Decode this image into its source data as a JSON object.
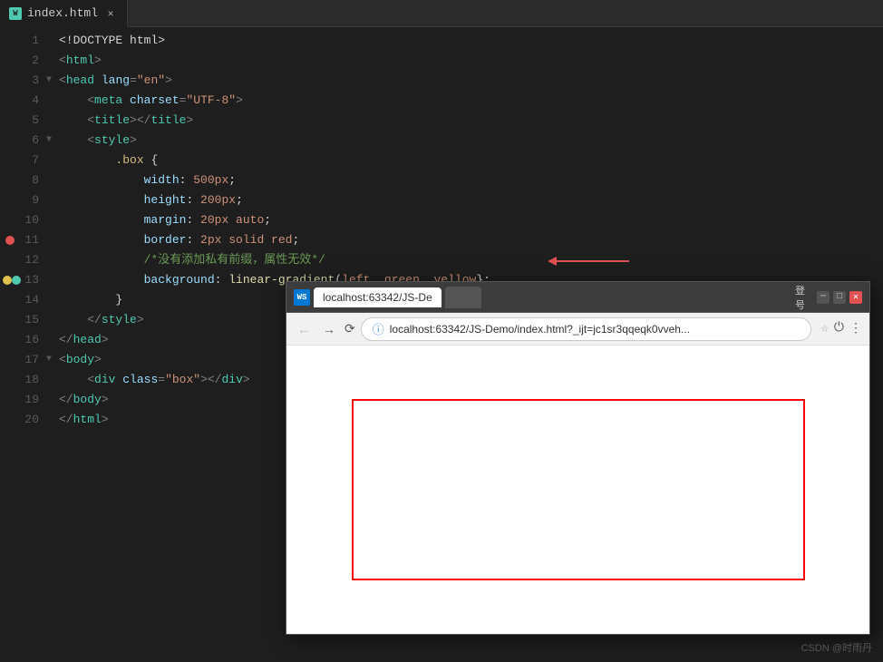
{
  "tab": {
    "name": "index.html",
    "icon_text": "WS"
  },
  "lines": [
    {
      "num": 1,
      "tokens": [
        {
          "t": "<!DOCTYPE html>",
          "c": "text-white"
        }
      ]
    },
    {
      "num": 2,
      "tokens": [
        {
          "t": "<",
          "c": "punct"
        },
        {
          "t": "html",
          "c": "tag"
        },
        {
          "t": ">",
          "c": "punct"
        }
      ]
    },
    {
      "num": 3,
      "tokens": [
        {
          "t": "<",
          "c": "punct"
        },
        {
          "t": "head",
          "c": "tag"
        },
        {
          "t": " ",
          "c": ""
        },
        {
          "t": "lang",
          "c": "attr"
        },
        {
          "t": "=",
          "c": "punct"
        },
        {
          "t": "\"en\"",
          "c": "val"
        },
        {
          "t": ">",
          "c": "punct"
        }
      ]
    },
    {
      "num": 4,
      "tokens": [
        {
          "t": "    <",
          "c": "punct"
        },
        {
          "t": "meta",
          "c": "tag"
        },
        {
          "t": " ",
          "c": ""
        },
        {
          "t": "charset",
          "c": "attr"
        },
        {
          "t": "=",
          "c": "punct"
        },
        {
          "t": "\"UTF-8\"",
          "c": "val"
        },
        {
          "t": ">",
          "c": "punct"
        }
      ]
    },
    {
      "num": 5,
      "tokens": [
        {
          "t": "    <",
          "c": "punct"
        },
        {
          "t": "title",
          "c": "tag"
        },
        {
          "t": "></",
          "c": "punct"
        },
        {
          "t": "title",
          "c": "tag"
        },
        {
          "t": ">",
          "c": "punct"
        }
      ]
    },
    {
      "num": 6,
      "tokens": [
        {
          "t": "    <",
          "c": "punct"
        },
        {
          "t": "style",
          "c": "tag"
        },
        {
          "t": ">",
          "c": "punct"
        }
      ]
    },
    {
      "num": 7,
      "tokens": [
        {
          "t": "        ",
          "c": ""
        },
        {
          "t": ".box",
          "c": "css-sel"
        },
        {
          "t": " {",
          "c": "text-white"
        }
      ]
    },
    {
      "num": 8,
      "tokens": [
        {
          "t": "            ",
          "c": ""
        },
        {
          "t": "width",
          "c": "css-prop"
        },
        {
          "t": ": ",
          "c": "text-white"
        },
        {
          "t": "500px",
          "c": "css-val"
        },
        {
          "t": ";",
          "c": "text-white"
        }
      ]
    },
    {
      "num": 9,
      "tokens": [
        {
          "t": "            ",
          "c": ""
        },
        {
          "t": "height",
          "c": "css-prop"
        },
        {
          "t": ": ",
          "c": "text-white"
        },
        {
          "t": "200px",
          "c": "css-val"
        },
        {
          "t": ";",
          "c": "text-white"
        }
      ]
    },
    {
      "num": 10,
      "tokens": [
        {
          "t": "            ",
          "c": ""
        },
        {
          "t": "margin",
          "c": "css-prop"
        },
        {
          "t": ": ",
          "c": "text-white"
        },
        {
          "t": "20px auto",
          "c": "css-val"
        },
        {
          "t": ";",
          "c": "text-white"
        }
      ]
    },
    {
      "num": 11,
      "tokens": [
        {
          "t": "            ",
          "c": ""
        },
        {
          "t": "border",
          "c": "css-prop"
        },
        {
          "t": ": ",
          "c": "text-white"
        },
        {
          "t": "2px solid red",
          "c": "css-val"
        },
        {
          "t": ";",
          "c": "text-white"
        }
      ]
    },
    {
      "num": 12,
      "tokens": [
        {
          "t": "            ",
          "c": ""
        },
        {
          "t": "/*没有添加私有前缀，属性无效*/",
          "c": "comment"
        }
      ]
    },
    {
      "num": 13,
      "tokens": [
        {
          "t": "            ",
          "c": ""
        },
        {
          "t": "background",
          "c": "css-prop"
        },
        {
          "t": ": ",
          "c": "text-white"
        },
        {
          "t": "linear-gradient",
          "c": "css-yellow"
        },
        {
          "t": "(",
          "c": "text-white"
        },
        {
          "t": "left, green, yellow",
          "c": "css-val"
        },
        {
          "t": "};",
          "c": "text-white"
        }
      ]
    },
    {
      "num": 14,
      "tokens": [
        {
          "t": "        }",
          "c": "text-white"
        }
      ]
    },
    {
      "num": 15,
      "tokens": [
        {
          "t": "    </",
          "c": "punct"
        },
        {
          "t": "style",
          "c": "tag"
        },
        {
          "t": ">",
          "c": "punct"
        }
      ]
    },
    {
      "num": 16,
      "tokens": [
        {
          "t": "</",
          "c": "punct"
        },
        {
          "t": "head",
          "c": "tag"
        },
        {
          "t": ">",
          "c": "punct"
        }
      ]
    },
    {
      "num": 17,
      "tokens": [
        {
          "t": "<",
          "c": "punct"
        },
        {
          "t": "body",
          "c": "tag"
        },
        {
          "t": ">",
          "c": "punct"
        }
      ]
    },
    {
      "num": 18,
      "tokens": [
        {
          "t": "    <",
          "c": "punct"
        },
        {
          "t": "div",
          "c": "tag"
        },
        {
          "t": " ",
          "c": ""
        },
        {
          "t": "class",
          "c": "attr"
        },
        {
          "t": "=",
          "c": "punct"
        },
        {
          "t": "\"box\"",
          "c": "val"
        },
        {
          "t": "></",
          "c": "punct"
        },
        {
          "t": "div",
          "c": "tag"
        },
        {
          "t": ">",
          "c": "punct"
        }
      ]
    },
    {
      "num": 19,
      "tokens": [
        {
          "t": "</",
          "c": "punct"
        },
        {
          "t": "body",
          "c": "tag"
        },
        {
          "t": ">",
          "c": "punct"
        }
      ]
    },
    {
      "num": 20,
      "tokens": [
        {
          "t": "</",
          "c": "punct"
        },
        {
          "t": "html",
          "c": "tag"
        },
        {
          "t": ">",
          "c": "punct"
        }
      ]
    }
  ],
  "breakpoints": {
    "line11": "red",
    "line13": "yellow-green"
  },
  "browser": {
    "title": "localhost:63342/JS-De...",
    "tab_label": "localhost:63342/JS-De",
    "url": "localhost:63342/JS-Demo/index.html?_ijt=jc1sr3qqeqk0vveh...",
    "win_label": "登号"
  },
  "watermark": {
    "text": "CSDN @时雨丹"
  }
}
